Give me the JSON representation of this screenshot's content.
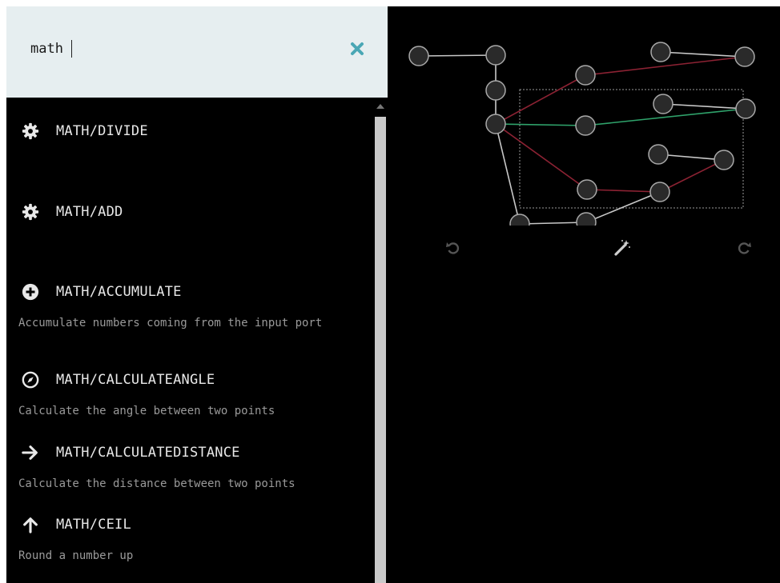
{
  "search": {
    "query": "math"
  },
  "results": [
    {
      "icon": "gear-icon",
      "title": "MATH/DIVIDE",
      "description": ""
    },
    {
      "icon": "gear-icon",
      "title": "MATH/ADD",
      "description": ""
    },
    {
      "icon": "plus-circle-icon",
      "title": "MATH/ACCUMULATE",
      "description": "Accumulate numbers coming from the input port"
    },
    {
      "icon": "compass-icon",
      "title": "MATH/CALCULATEANGLE",
      "description": "Calculate the angle between two points"
    },
    {
      "icon": "arrow-right-icon",
      "title": "MATH/CALCULATEDISTANCE",
      "description": "Calculate the distance between two points"
    },
    {
      "icon": "arrow-up-icon",
      "title": "MATH/CEIL",
      "description": "Round a number up"
    }
  ],
  "graph_toolbar": {
    "undo_icon": "undo-icon",
    "autolayout_icon": "magic-wand-icon",
    "redo_icon": "redo-icon"
  },
  "colors": {
    "search_bar_bg": "#e6eef0",
    "clear_icon": "#4aa7b5",
    "edge_red": "#8c2233",
    "edge_green": "#2fa36b",
    "edge_white": "#c8c8c8",
    "node_fill": "#2a2a2a"
  }
}
